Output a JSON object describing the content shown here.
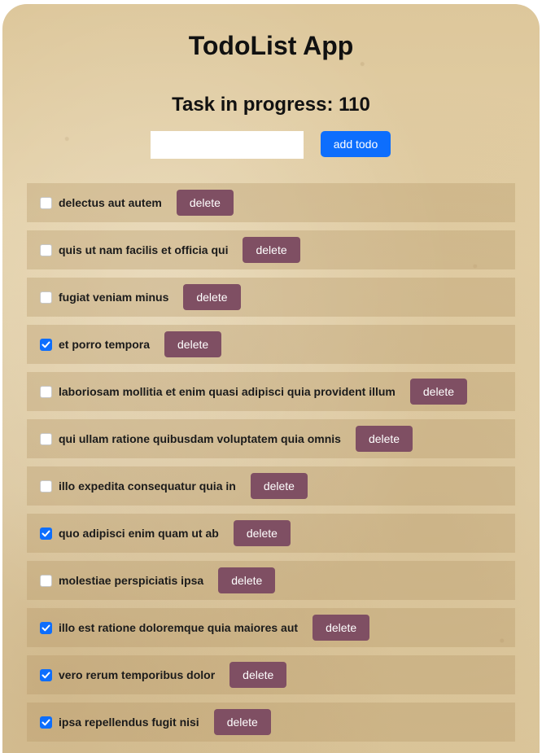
{
  "app": {
    "title": "TodoList App",
    "progress_text": "Task in progress: 110"
  },
  "form": {
    "input_value": "",
    "input_placeholder": "",
    "add_label": "add todo"
  },
  "colors": {
    "add_button": "#0d6efd",
    "delete_button": "#7f4f63",
    "checkbox_checked": "#0d6efd"
  },
  "todos": [
    {
      "title": "delectus aut autem",
      "completed": false,
      "delete_label": "delete"
    },
    {
      "title": "quis ut nam facilis et officia qui",
      "completed": false,
      "delete_label": "delete"
    },
    {
      "title": "fugiat veniam minus",
      "completed": false,
      "delete_label": "delete"
    },
    {
      "title": "et porro tempora",
      "completed": true,
      "delete_label": "delete"
    },
    {
      "title": "laboriosam mollitia et enim quasi adipisci quia provident illum",
      "completed": false,
      "delete_label": "delete"
    },
    {
      "title": "qui ullam ratione quibusdam voluptatem quia omnis",
      "completed": false,
      "delete_label": "delete"
    },
    {
      "title": "illo expedita consequatur quia in",
      "completed": false,
      "delete_label": "delete"
    },
    {
      "title": "quo adipisci enim quam ut ab",
      "completed": true,
      "delete_label": "delete"
    },
    {
      "title": "molestiae perspiciatis ipsa",
      "completed": false,
      "delete_label": "delete"
    },
    {
      "title": "illo est ratione doloremque quia maiores aut",
      "completed": true,
      "delete_label": "delete"
    },
    {
      "title": "vero rerum temporibus dolor",
      "completed": true,
      "delete_label": "delete"
    },
    {
      "title": "ipsa repellendus fugit nisi",
      "completed": true,
      "delete_label": "delete"
    }
  ]
}
